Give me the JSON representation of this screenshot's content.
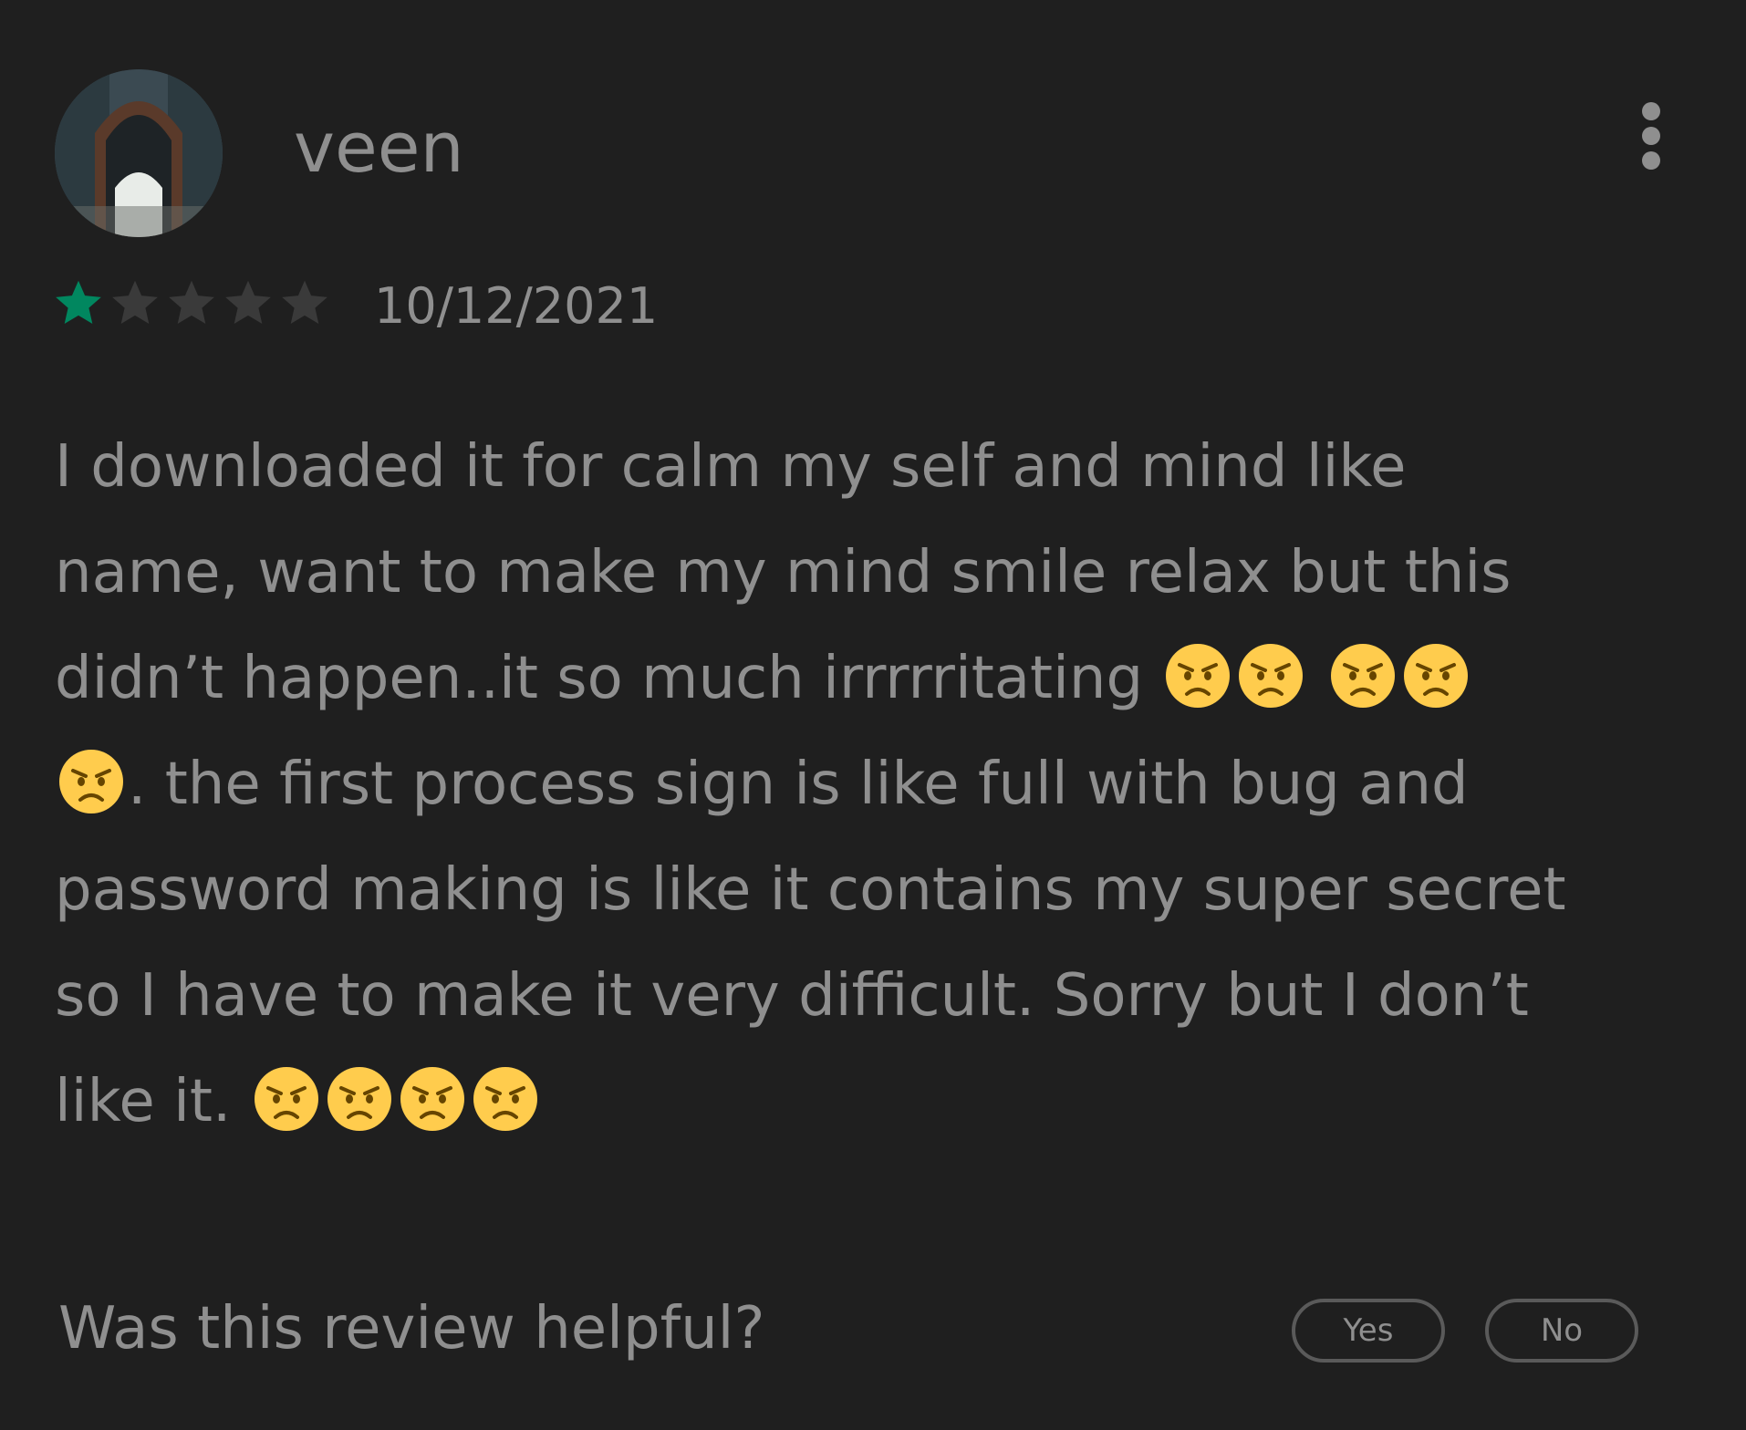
{
  "review": {
    "username": "veen",
    "rating": 1,
    "max_rating": 5,
    "date": "10/12/2021",
    "lines": [
      [
        "I downloaded it for calm my self and mind like"
      ],
      [
        "name, want to make my mind smile relax but this"
      ],
      [
        "didn’t happen..it so much irrrrritating ",
        "emoji",
        "emoji",
        " ",
        "emoji",
        "emoji"
      ],
      [
        "emoji",
        ". the first process sign is like full with bug and"
      ],
      [
        "password making is like it contains my super secret"
      ],
      [
        "so I have to make it very difficult. Sorry but I don’t"
      ],
      [
        "like it. ",
        "emoji",
        "emoji",
        "emoji",
        "emoji"
      ]
    ],
    "emoji_icon": "angry-face-icon"
  },
  "feedback": {
    "question": "Was this review helpful?",
    "yes_label": "Yes",
    "no_label": "No"
  },
  "colors": {
    "background": "#1f1f1f",
    "text": "#8f8f8f",
    "star_filled": "#01875f",
    "star_empty": "#3a3a3a",
    "button_border": "#5a5a5a",
    "emoji": "#ffcc4d"
  },
  "icons": {
    "menu": "more-vertical-icon",
    "star": "star-icon"
  }
}
